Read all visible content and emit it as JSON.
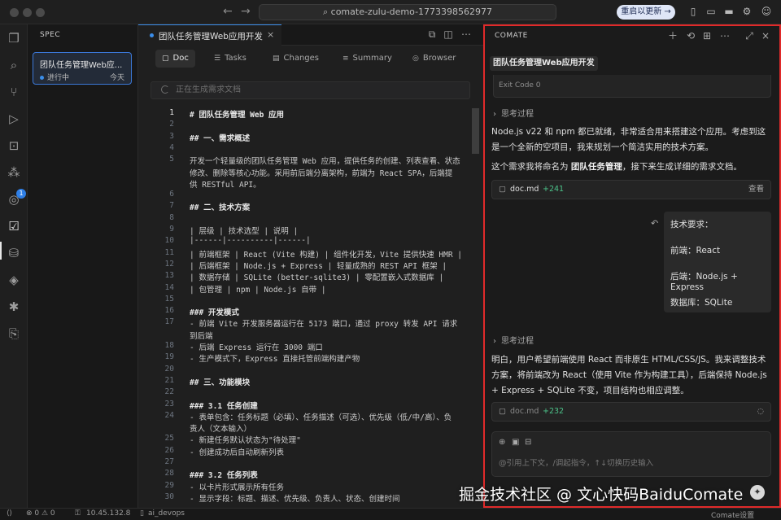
{
  "titlebar": {
    "search": "comate-zulu-demo-1773398562977",
    "restart_label": "重启以更新 →"
  },
  "sidebar": {
    "title": "SPEC",
    "card_name": "团队任务管理Web应...",
    "card_status": "进行中",
    "card_time": "今天",
    "badge_count": "1"
  },
  "editor": {
    "tab_label": "团队任务管理Web应用开发",
    "tab_close": "×",
    "view_tabs": [
      "Doc",
      "Tasks",
      "Changes",
      "Summary",
      "Browser"
    ],
    "generating": "正在生成需求文档",
    "lines": [
      {
        "n": "1",
        "t": "# 团队任务管理 Web 应用",
        "h": true
      },
      {
        "n": "2",
        "t": ""
      },
      {
        "n": "3",
        "t": "## 一、需求概述",
        "h": true
      },
      {
        "n": "4",
        "t": ""
      },
      {
        "n": "5",
        "t": "开发一个轻量级的团队任务管理 Web 应用，提供任务的创建、列表查看、状态"
      },
      {
        "n": "",
        "t": "修改、删除等核心功能。采用前后端分离架构，前端为 React SPA，后端提"
      },
      {
        "n": "",
        "t": "供 RESTful API。"
      },
      {
        "n": "6",
        "t": ""
      },
      {
        "n": "7",
        "t": "## 二、技术方案",
        "h": true
      },
      {
        "n": "8",
        "t": ""
      },
      {
        "n": "9",
        "t": "| 层级 | 技术选型 | 说明 |"
      },
      {
        "n": "10",
        "t": "|------|----------|------|"
      },
      {
        "n": "11",
        "t": "| 前端框架 | React (Vite 构建) | 组件化开发，Vite 提供快速 HMR |"
      },
      {
        "n": "12",
        "t": "| 后端框架 | Node.js + Express | 轻量成熟的 REST API 框架 |"
      },
      {
        "n": "13",
        "t": "| 数据存储 | SQLite (better-sqlite3) | 零配置嵌入式数据库 |"
      },
      {
        "n": "14",
        "t": "| 包管理 | npm | Node.js 自带 |"
      },
      {
        "n": "15",
        "t": ""
      },
      {
        "n": "16",
        "t": "### 开发模式",
        "h": true
      },
      {
        "n": "17",
        "t": "- 前端 Vite 开发服务器运行在 5173 端口，通过 proxy 转发 API 请求"
      },
      {
        "n": "",
        "t": "到后端"
      },
      {
        "n": "18",
        "t": "- 后端 Express 运行在 3000 端口"
      },
      {
        "n": "19",
        "t": "- 生产模式下，Express 直接托管前端构建产物"
      },
      {
        "n": "20",
        "t": ""
      },
      {
        "n": "21",
        "t": "## 三、功能模块",
        "h": true
      },
      {
        "n": "22",
        "t": ""
      },
      {
        "n": "23",
        "t": "### 3.1 任务创建",
        "h": true
      },
      {
        "n": "24",
        "t": "- 表单包含：任务标题（必填）、任务描述（可选）、优先级（低/中/高）、负"
      },
      {
        "n": "",
        "t": "责人（文本输入）"
      },
      {
        "n": "25",
        "t": "- 新建任务默认状态为\"待处理\""
      },
      {
        "n": "26",
        "t": "- 创建成功后自动刷新列表"
      },
      {
        "n": "27",
        "t": ""
      },
      {
        "n": "28",
        "t": "### 3.2 任务列表",
        "h": true
      },
      {
        "n": "29",
        "t": "- 以卡片形式展示所有任务"
      },
      {
        "n": "30",
        "t": "- 显示字段：标题、描述、优先级、负责人、状态、创建时间"
      }
    ]
  },
  "chat": {
    "title": "COMATE",
    "subtitle": "团队任务管理Web应用开发",
    "exit_code": "Exit Code 0",
    "think_label": "思考过程",
    "para1": "Node.js v22 和 npm 都已就绪，非常适合用来搭建这个应用。考虑到这是一个全新的空项目，我来规划一个简洁实用的技术方案。",
    "para2_pre": "这个需求我将命名为 ",
    "para2_bold": "团队任务管理",
    "para2_post": "，接下来生成详细的需求文档。",
    "file1_name": "doc.md",
    "file1_diff": "+241",
    "file1_action": "查看",
    "user_title": "技术要求：",
    "user_front": "前端：React",
    "user_back": "后端：Node.js + Express",
    "user_db": "数据库：SQLite",
    "para3": "明白，用户希望前端使用 React 而非原生 HTML/CSS/JS。我来调整技术方案，将前端改为 React（使用 Vite 作为构建工具），后端保持 Node.js + Express + SQLite 不变，项目结构也相应调整。",
    "file2_name": "doc.md",
    "file2_diff": "+232",
    "input_placeholder": "@引用上下文，/调起指令，↑↓切换历史输入"
  },
  "statusbar": {
    "errors": "⊗ 0 ⚠ 0",
    "remote": "10.45.132.8",
    "branch": "ai_devops",
    "right": "Comate设置"
  },
  "watermark": "掘金技术社区 @ 文心快码BaiduComate"
}
